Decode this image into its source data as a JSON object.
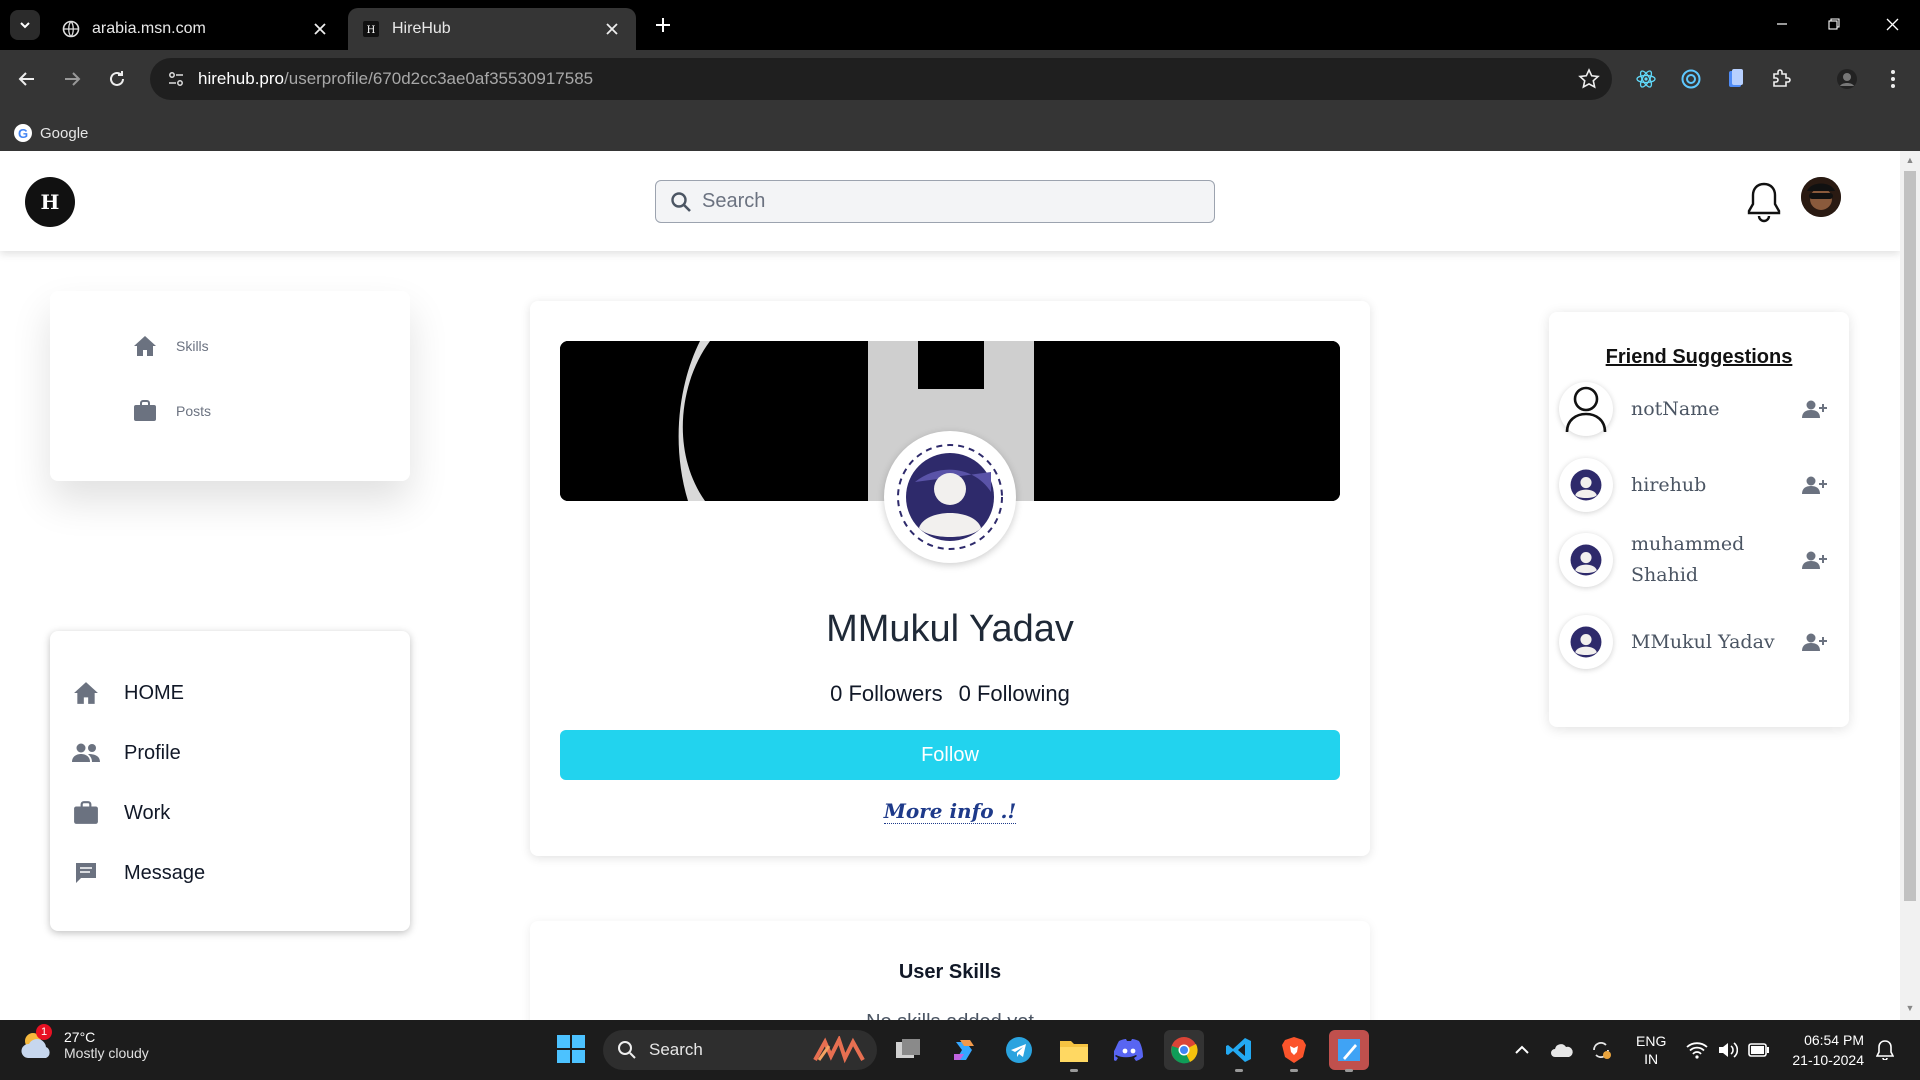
{
  "browser": {
    "tabs": [
      {
        "title": "arabia.msn.com",
        "active": false
      },
      {
        "title": "HireHub",
        "active": true
      }
    ],
    "url_host": "hirehub.pro",
    "url_path": "/userprofile/670d2cc3ae0af35530917585",
    "bookmarks": [
      {
        "label": "Google"
      }
    ]
  },
  "app": {
    "logo_letter": "H",
    "search_placeholder": "Search"
  },
  "left_top_menu": [
    {
      "label": "Skills",
      "icon": "home-icon"
    },
    {
      "label": "Posts",
      "icon": "briefcase-icon"
    }
  ],
  "left_nav": [
    {
      "label": "HOME",
      "icon": "home-icon"
    },
    {
      "label": "Profile",
      "icon": "people-icon"
    },
    {
      "label": "Work",
      "icon": "briefcase-icon"
    },
    {
      "label": "Message",
      "icon": "message-icon"
    }
  ],
  "profile": {
    "name": "MMukul Yadav",
    "followers": "0 Followers",
    "following": "0 Following",
    "follow_label": "Follow",
    "more_info_label": "More info .!"
  },
  "skills": {
    "title": "User Skills",
    "empty_text": "No skills added yet"
  },
  "friends": {
    "title": "Friend Suggestions",
    "items": [
      {
        "name": "notName"
      },
      {
        "name": "hirehub"
      },
      {
        "name": "muhammed Shahid"
      },
      {
        "name": "MMukul Yadav"
      }
    ]
  },
  "taskbar": {
    "weather_badge": "1",
    "temperature": "27°C",
    "condition": "Mostly cloudy",
    "search_label": "Search",
    "lang_line1": "ENG",
    "lang_line2": "IN",
    "time": "06:54 PM",
    "date": "21-10-2024"
  },
  "colors": {
    "follow_button": "#22d3ee",
    "more_info_link": "#1e3a8a",
    "avatar_accent": "#2e2a6b"
  }
}
